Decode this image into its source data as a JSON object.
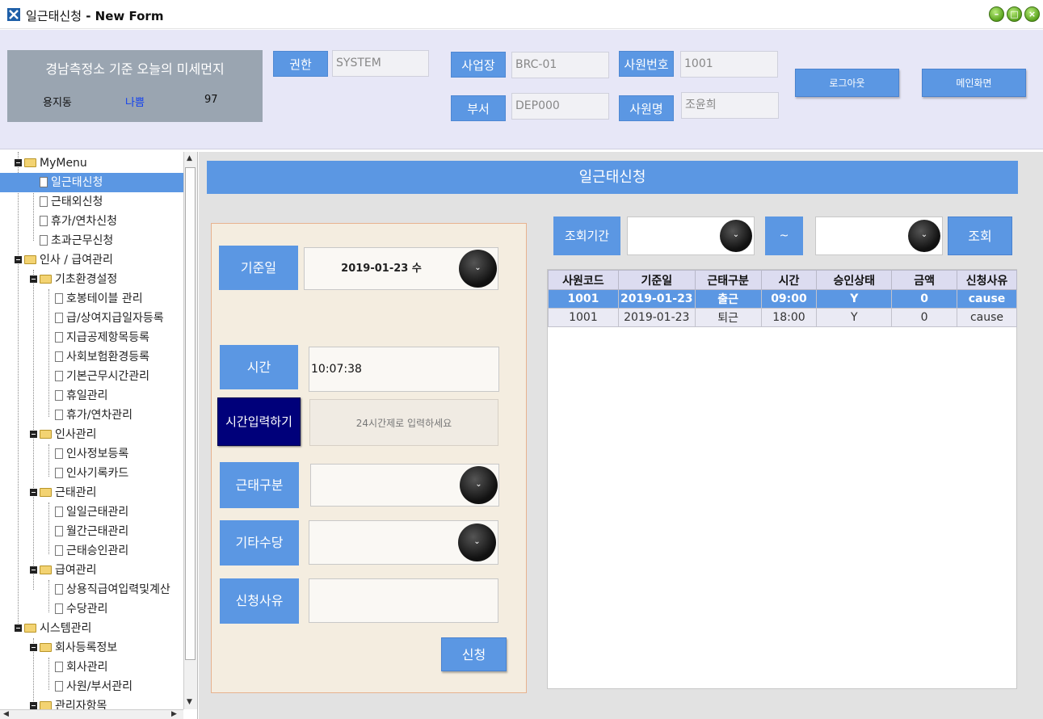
{
  "window": {
    "title_prefix": "일근태신청",
    "title_suffix": " - New Form"
  },
  "header": {
    "dust": {
      "title": "경남측정소 기준 오늘의 미세먼지",
      "location": "용지동",
      "level": "나쁨",
      "value": "97"
    },
    "auth_label": "권한",
    "auth_value": "SYSTEM",
    "site_label": "사업장",
    "site_value": "BRC-01",
    "emp_no_label": "사원번호",
    "emp_no_value": "1001",
    "dept_label": "부서",
    "dept_value": "DEP000",
    "emp_name_label": "사원명",
    "emp_name_value": "조윤희",
    "logout_label": "로그아웃",
    "main_label": "메인화면"
  },
  "tree": [
    {
      "label": "MyMenu",
      "type": "folder",
      "level": 0
    },
    {
      "label": "일근태신청",
      "type": "doc",
      "level": 1,
      "selected": true
    },
    {
      "label": "근태외신청",
      "type": "doc",
      "level": 1
    },
    {
      "label": "휴가/연차신청",
      "type": "doc",
      "level": 1
    },
    {
      "label": "초과근무신청",
      "type": "doc",
      "level": 1
    },
    {
      "label": "인사 / 급여관리",
      "type": "folder",
      "level": 0
    },
    {
      "label": "기초환경설정",
      "type": "folder",
      "level": 1
    },
    {
      "label": "호봉테이블 관리",
      "type": "doc",
      "level": 2
    },
    {
      "label": "급/상여지급일자등록",
      "type": "doc",
      "level": 2
    },
    {
      "label": "지급공제항목등록",
      "type": "doc",
      "level": 2
    },
    {
      "label": "사회보험환경등록",
      "type": "doc",
      "level": 2
    },
    {
      "label": "기본근무시간관리",
      "type": "doc",
      "level": 2
    },
    {
      "label": "휴일관리",
      "type": "doc",
      "level": 2
    },
    {
      "label": "휴가/연차관리",
      "type": "doc",
      "level": 2
    },
    {
      "label": "인사관리",
      "type": "folder",
      "level": 1
    },
    {
      "label": "인사정보등록",
      "type": "doc",
      "level": 2
    },
    {
      "label": "인사기록카드",
      "type": "doc",
      "level": 2
    },
    {
      "label": "근태관리",
      "type": "folder",
      "level": 1
    },
    {
      "label": "일일근태관리",
      "type": "doc",
      "level": 2
    },
    {
      "label": "월간근태관리",
      "type": "doc",
      "level": 2
    },
    {
      "label": "근태승인관리",
      "type": "doc",
      "level": 2
    },
    {
      "label": "급여관리",
      "type": "folder",
      "level": 1
    },
    {
      "label": "상용직급여입력및계산",
      "type": "doc",
      "level": 2
    },
    {
      "label": "수당관리",
      "type": "doc",
      "level": 2
    },
    {
      "label": "시스템관리",
      "type": "folder",
      "level": 0
    },
    {
      "label": "회사등록정보",
      "type": "folder",
      "level": 1
    },
    {
      "label": "회사관리",
      "type": "doc",
      "level": 2
    },
    {
      "label": "사원/부서관리",
      "type": "doc",
      "level": 2
    },
    {
      "label": "관리자항목",
      "type": "folder",
      "level": 1
    }
  ],
  "main": {
    "banner": "일근태신청",
    "form": {
      "base_date_label": "기준일",
      "base_date_value": "2019-01-23 수",
      "time_label": "시간",
      "time_value": "10:07:38",
      "time_input_button": "시간입력하기",
      "time_hint": "24시간제로 입력하세요",
      "type_label": "근태구분",
      "allowance_label": "기타수당",
      "reason_label": "신청사유",
      "submit_label": "신청"
    },
    "search": {
      "period_label": "조회기간",
      "tilde": "~",
      "search_label": "조회"
    },
    "grid": {
      "columns": [
        "사원코드",
        "기준일",
        "근태구분",
        "시간",
        "승인상태",
        "금액",
        "신청사유"
      ],
      "rows": [
        [
          "1001",
          "2019-01-23",
          "출근",
          "09:00",
          "Y",
          "0",
          "cause"
        ],
        [
          "1001",
          "2019-01-23",
          "퇴근",
          "18:00",
          "Y",
          "0",
          "cause"
        ]
      ],
      "selected_row": 0
    }
  },
  "colors": {
    "accent": "#5b97e3",
    "header_bg": "#e7e7f7",
    "panel_bg": "#f4ede0",
    "dark_button": "#00007a"
  },
  "icons": {
    "dropdown": "chevron-down-icon",
    "minimize": "minimize-icon",
    "maximize": "maximize-icon",
    "close": "close-icon"
  }
}
